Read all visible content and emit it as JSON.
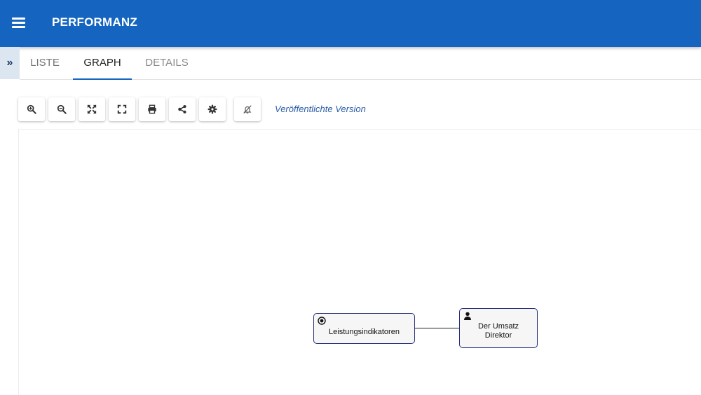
{
  "app": {
    "title": "PERFORMANZ"
  },
  "tabs": [
    {
      "label": "LISTE"
    },
    {
      "label": "GRAPH"
    },
    {
      "label": "DETAILS"
    }
  ],
  "sidebar_toggle": {
    "glyph": "»"
  },
  "toolbar": {
    "buttons": [
      {
        "icon": "zoom-in-icon"
      },
      {
        "icon": "zoom-out-icon"
      },
      {
        "icon": "fit-to-screen-icon"
      },
      {
        "icon": "fullscreen-icon"
      },
      {
        "icon": "print-icon"
      },
      {
        "icon": "share-icon"
      },
      {
        "icon": "settings-icon"
      },
      {
        "icon": "notifications-off-icon"
      }
    ],
    "version_label": "Veröffentlichte Version"
  },
  "graph": {
    "nodes": [
      {
        "label": "Leistungsindikatoren",
        "icon": "target-icon"
      },
      {
        "label": "Der Umsatz\nDirektor",
        "icon": "user-icon"
      }
    ]
  },
  "colors": {
    "appbar": "#1565c0",
    "active_tab_indicator": "#1565c0",
    "version_label": "#2a5da8",
    "node_border": "#26307a"
  }
}
